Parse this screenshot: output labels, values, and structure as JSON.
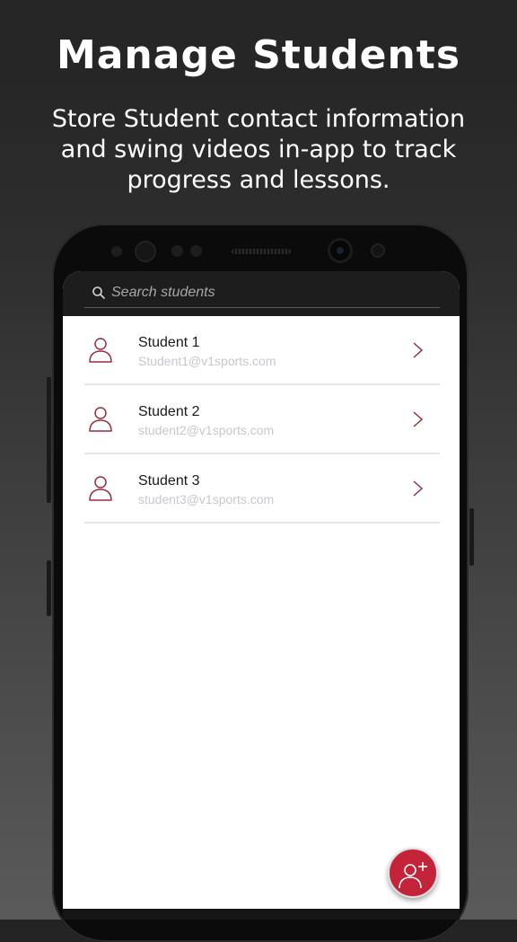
{
  "promo": {
    "headline": "Manage Students",
    "subheadline": "Store Student contact information and swing videos in-app to track progress and lessons."
  },
  "search": {
    "placeholder": "Search students",
    "value": "",
    "icon": "search-icon"
  },
  "students": [
    {
      "name": "Student 1",
      "email": "Student1@v1sports.com"
    },
    {
      "name": "Student 2",
      "email": "student2@v1sports.com"
    },
    {
      "name": "Student 3",
      "email": "student3@v1sports.com"
    }
  ],
  "fab": {
    "icon": "add-user-icon"
  },
  "colors": {
    "accent": "#c4243a",
    "icon_accent": "#9b2c3e",
    "email_text": "#c7c7cf",
    "header_bg": "#1d1d1d"
  }
}
